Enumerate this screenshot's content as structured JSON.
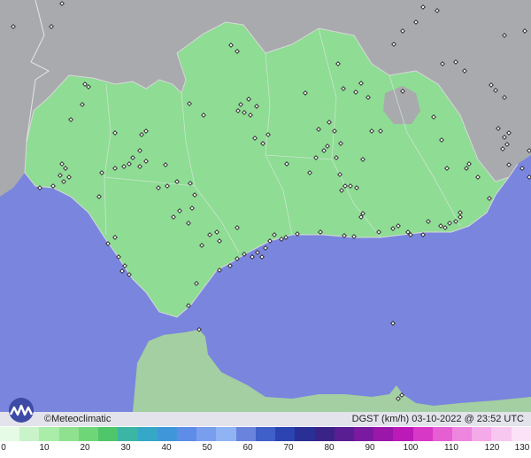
{
  "map": {
    "colors": {
      "sea": "#7a85de",
      "foreign_land": "#a9aaae",
      "region_land": "#8fdc95",
      "morocco_land": "#a3cfa2",
      "border": "#e6e6e6",
      "station": "#222222"
    }
  },
  "footer": {
    "credit": "©Meteoclimatic",
    "info": "DGST (km/h)  03-10-2022 @ 23:52 UTC"
  },
  "legend": {
    "ticks": [
      "0",
      "10",
      "20",
      "30",
      "40",
      "50",
      "60",
      "70",
      "80",
      "90",
      "100",
      "110",
      "120",
      "130"
    ],
    "colors": [
      "#e6fbe6",
      "#c9f3c9",
      "#a9eda9",
      "#8fe190",
      "#6fd678",
      "#4fc66a",
      "#3bb5a4",
      "#35a7c7",
      "#3f97d9",
      "#5d8de6",
      "#7a9eee",
      "#8fb3f3",
      "#6a83dc",
      "#3f5fc9",
      "#2b44b1",
      "#2a2f95",
      "#3a2386",
      "#5a1e93",
      "#7a1aa0",
      "#9b17aa",
      "#bb19b8",
      "#d838c6",
      "#e55fd3",
      "#ee85de",
      "#f4a9e8",
      "#f8c7f0",
      "#fbe2f7"
    ]
  }
}
